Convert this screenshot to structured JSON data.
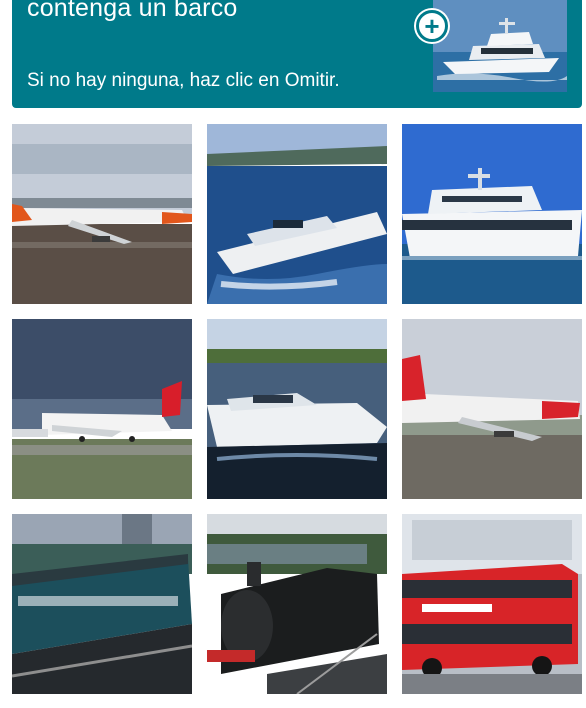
{
  "challenge": {
    "prompt_line": "contenga un barco",
    "skip_hint": "Si no hay ninguna, haz clic en Omitir.",
    "example_icon": "plus-icon",
    "accent_color": "#007a8a"
  },
  "tiles": [
    {
      "subject": "airplane"
    },
    {
      "subject": "speedboat"
    },
    {
      "subject": "yacht"
    },
    {
      "subject": "airplane"
    },
    {
      "subject": "speedboat"
    },
    {
      "subject": "airplane"
    },
    {
      "subject": "train"
    },
    {
      "subject": "steam-locomotive"
    },
    {
      "subject": "double-decker-bus"
    }
  ]
}
